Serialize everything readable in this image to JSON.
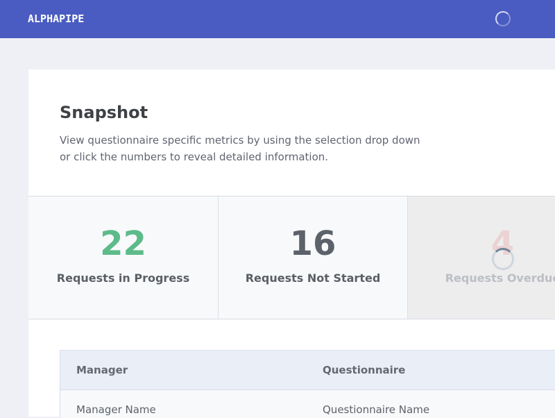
{
  "header": {
    "logo": "ALPHAPIPE",
    "bg_color": "#4a5cc1"
  },
  "snapshot": {
    "title": "Snapshot",
    "description": "View questionnaire specific metrics by using the selection drop down or click the numbers to reveal detailed information."
  },
  "metrics": [
    {
      "value": "22",
      "label": "Requests in Progress",
      "color": "#5dbb8a"
    },
    {
      "value": "16",
      "label": "Requests Not Started",
      "color": "#5c6269"
    },
    {
      "value": "4",
      "label": "Requests Overdue",
      "color": "#e45b5b",
      "state": "loading"
    }
  ],
  "table": {
    "columns": [
      "Manager",
      "Questionnaire"
    ],
    "rows": [
      [
        "Manager Name",
        "Questionnaire Name"
      ]
    ]
  }
}
